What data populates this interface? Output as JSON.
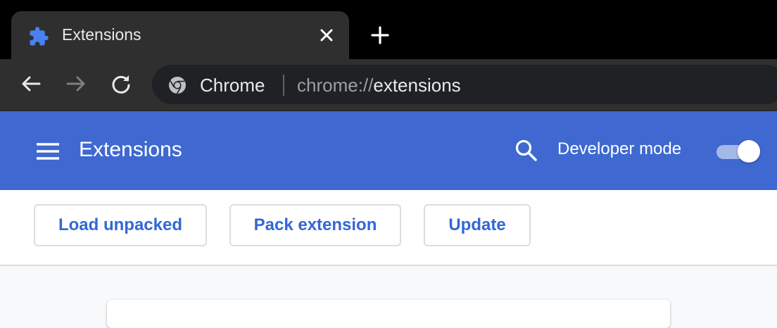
{
  "tab": {
    "title": "Extensions",
    "icon": "puzzle-icon"
  },
  "omnibox": {
    "chip": "Chrome",
    "url_scheme": "chrome://",
    "url_host": "extensions"
  },
  "header": {
    "title": "Extensions",
    "developer_mode_label": "Developer mode",
    "developer_mode_on": true
  },
  "actions": {
    "load_unpacked": "Load unpacked",
    "pack_extension": "Pack extension",
    "update": "Update"
  },
  "colors": {
    "header_bg": "#3f69d1",
    "accent_text": "#3367d6",
    "tab_bg": "#2f2f2f"
  }
}
